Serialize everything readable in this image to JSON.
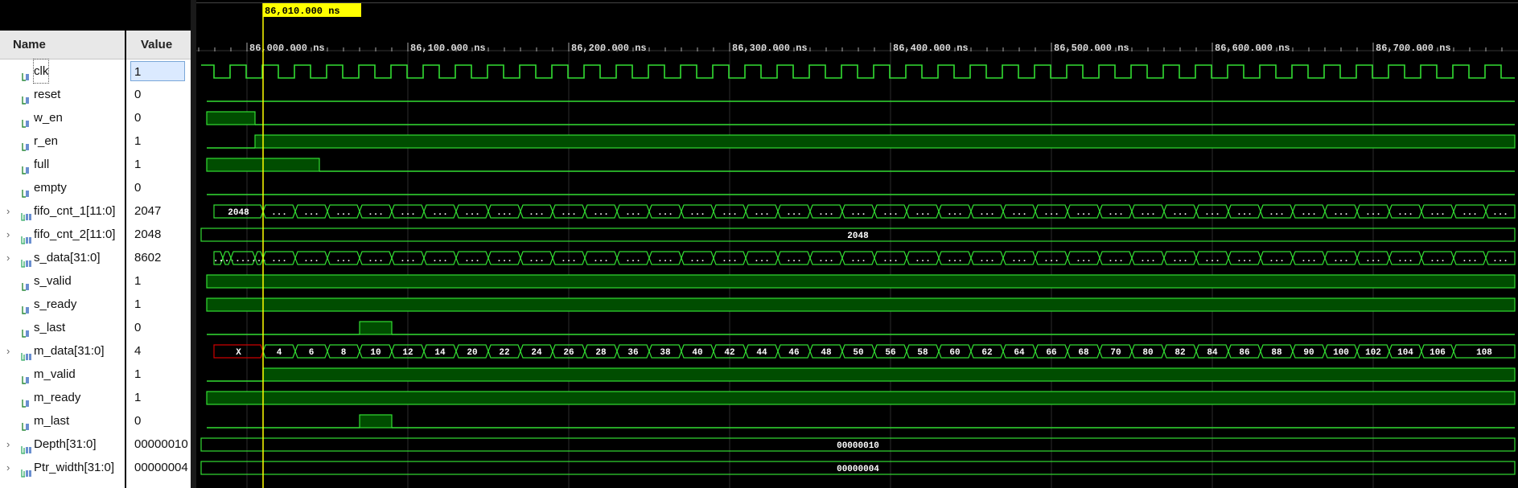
{
  "header": {
    "name_col": "Name",
    "value_col": "Value"
  },
  "cursor": {
    "label": "86,010.000 ns",
    "time_ns": 86010
  },
  "time_axis": {
    "start_ns": 85989.5,
    "ns_per_100": 100,
    "ticks": [
      "86,000.000 ns",
      "86,100.000 ns",
      "86,200.000 ns",
      "86,300.000 ns",
      "86,400.000 ns",
      "86,500.000 ns",
      "86,600.000 ns",
      "86,700.000 ns"
    ]
  },
  "colors": {
    "wave": "#33dd33",
    "fill": "#004d00",
    "cursor": "#ffff00",
    "undefined": "#cc0000",
    "bus_text": "#ffffff"
  },
  "signals": [
    {
      "name": "clk",
      "value": "1",
      "kind": "bit",
      "expandable": false,
      "selected": true,
      "icon": "bit-signal-icon"
    },
    {
      "name": "reset",
      "value": "0",
      "kind": "bit",
      "expandable": false,
      "icon": "bit-signal-icon"
    },
    {
      "name": "w_en",
      "value": "0",
      "kind": "bit",
      "expandable": false,
      "icon": "bit-signal-icon"
    },
    {
      "name": "r_en",
      "value": "1",
      "kind": "bit",
      "expandable": false,
      "icon": "bit-signal-icon"
    },
    {
      "name": "full",
      "value": "1",
      "kind": "bit",
      "expandable": false,
      "icon": "bit-signal-icon"
    },
    {
      "name": "empty",
      "value": "0",
      "kind": "bit",
      "expandable": false,
      "icon": "bit-signal-icon"
    },
    {
      "name": "fifo_cnt_1[11:0]",
      "value": "2047",
      "kind": "bus",
      "expandable": true,
      "icon": "bus-signal-icon"
    },
    {
      "name": "fifo_cnt_2[11:0]",
      "value": "2048",
      "kind": "bus",
      "expandable": true,
      "icon": "bus-signal-icon"
    },
    {
      "name": "s_data[31:0]",
      "value": "8602",
      "kind": "bus",
      "expandable": true,
      "icon": "bus-signal-icon"
    },
    {
      "name": "s_valid",
      "value": "1",
      "kind": "bit",
      "expandable": false,
      "icon": "bit-signal-icon"
    },
    {
      "name": "s_ready",
      "value": "1",
      "kind": "bit",
      "expandable": false,
      "icon": "bit-signal-icon"
    },
    {
      "name": "s_last",
      "value": "0",
      "kind": "bit",
      "expandable": false,
      "icon": "bit-signal-icon"
    },
    {
      "name": "m_data[31:0]",
      "value": "4",
      "kind": "bus",
      "expandable": true,
      "icon": "bus-signal-icon"
    },
    {
      "name": "m_valid",
      "value": "1",
      "kind": "bit",
      "expandable": false,
      "icon": "bit-signal-icon"
    },
    {
      "name": "m_ready",
      "value": "1",
      "kind": "bit",
      "expandable": false,
      "icon": "bit-signal-icon"
    },
    {
      "name": "m_last",
      "value": "0",
      "kind": "bit",
      "expandable": false,
      "icon": "bit-signal-icon"
    },
    {
      "name": "Depth[31:0]",
      "value": "00000010",
      "kind": "bus",
      "expandable": true,
      "icon": "bus-signal-icon"
    },
    {
      "name": "Ptr_width[31:0]",
      "value": "00000004",
      "kind": "bus",
      "expandable": true,
      "icon": "bus-signal-icon"
    }
  ],
  "waves": {
    "clk": {
      "type": "clock",
      "period_ns": 20,
      "first_rise_ns": 85989.5
    },
    "reset": {
      "type": "bit",
      "edges": [
        [
          85975,
          0
        ]
      ]
    },
    "w_en": {
      "type": "bit",
      "edges": [
        [
          85975,
          1
        ],
        [
          86005,
          0
        ]
      ]
    },
    "r_en": {
      "type": "bit",
      "edges": [
        [
          85975,
          0
        ],
        [
          86005,
          1
        ]
      ]
    },
    "full": {
      "type": "bit",
      "edges": [
        [
          85975,
          1
        ],
        [
          86045,
          0
        ]
      ]
    },
    "empty": {
      "type": "bit",
      "edges": [
        [
          85975,
          0
        ]
      ]
    },
    "fifo_cnt_1": {
      "type": "bus",
      "start_label": "2048",
      "first_change_ns": 86010,
      "period_ns": 20,
      "repeat_label": "..."
    },
    "fifo_cnt_2": {
      "type": "bus_const",
      "label": "2048"
    },
    "s_data": {
      "type": "bus",
      "start_label": "..",
      "first_change_ns": 85990,
      "period_ns": 20,
      "repeat_label": "...",
      "extra_changes": [
        85985,
        86005
      ]
    },
    "s_valid": {
      "type": "bit",
      "edges": [
        [
          85975,
          1
        ]
      ]
    },
    "s_ready": {
      "type": "bit",
      "edges": [
        [
          85975,
          1
        ]
      ]
    },
    "s_last": {
      "type": "bit",
      "edges": [
        [
          85975,
          0
        ],
        [
          86070,
          1
        ],
        [
          86090,
          0
        ]
      ]
    },
    "m_data": {
      "type": "bus_labels",
      "undefined_label": "X",
      "undefined_until_ns": 86010,
      "period_ns": 20,
      "labels": [
        "4",
        "6",
        "8",
        "10",
        "12",
        "14",
        "20",
        "22",
        "24",
        "26",
        "28",
        "36",
        "38",
        "40",
        "42",
        "44",
        "46",
        "48",
        "50",
        "56",
        "58",
        "60",
        "62",
        "64",
        "66",
        "68",
        "70",
        "80",
        "82",
        "84",
        "86",
        "88",
        "90",
        "100",
        "102",
        "104",
        "106",
        "108"
      ]
    },
    "m_valid": {
      "type": "bit",
      "edges": [
        [
          85975,
          0
        ],
        [
          86010,
          1
        ]
      ]
    },
    "m_ready": {
      "type": "bit",
      "edges": [
        [
          85975,
          1
        ]
      ]
    },
    "m_last": {
      "type": "bit",
      "edges": [
        [
          85975,
          0
        ],
        [
          86070,
          1
        ],
        [
          86090,
          0
        ]
      ]
    },
    "Depth": {
      "type": "bus_const",
      "label": "00000010"
    },
    "Ptr_width": {
      "type": "bus_const",
      "label": "00000004"
    }
  }
}
